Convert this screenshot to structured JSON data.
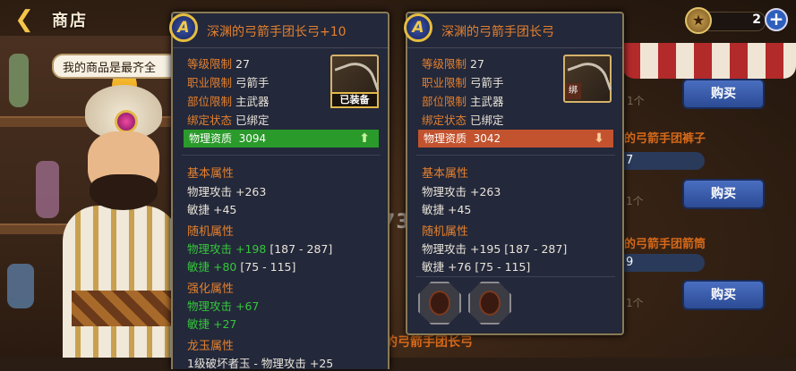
{
  "topbar": {
    "back_icon": "back-arrow-icon",
    "title": "商店"
  },
  "currency": {
    "value": "2",
    "icon": "medal-icon",
    "plus_label": "+"
  },
  "bubble": {
    "text": "我的商品是最齐全"
  },
  "shop_list": {
    "items": [
      {
        "qty": "1个",
        "buy": "购买"
      },
      {
        "title": "的弓箭手团裤子",
        "qty": "7",
        "qty2": "1个",
        "buy": "购买"
      },
      {
        "title": "的弓箭手团箭筒",
        "qty": "9",
        "qty2": "1个",
        "buy": "购买"
      }
    ],
    "bottom_title": "的弓箭手团长弓"
  },
  "watermark": "K73",
  "left_panel": {
    "grade": "A",
    "name": "深渊的弓箭手团长弓+10",
    "level_label": "等级限制",
    "level": "27",
    "class_label": "职业限制",
    "class": "弓箭手",
    "slot_label": "部位限制",
    "slot": "主武器",
    "bind_label": "绑定状态",
    "bind": "已绑定",
    "equipped_tag": "已装备",
    "aptitude_label": "物理资质",
    "aptitude": "3094",
    "base_title": "基本属性",
    "base_stats": [
      "物理攻击 +263",
      "敏捷 +45"
    ],
    "random_title": "随机属性",
    "random_stats": [
      {
        "name": "物理攻击",
        "bonus": "+198",
        "range": "[187 - 287]"
      },
      {
        "name": "敏捷",
        "bonus": "+80",
        "range": "[75 - 115]"
      }
    ],
    "enhance_title": "强化属性",
    "enhance_stats": [
      {
        "name": "物理攻击",
        "bonus": "+67"
      },
      {
        "name": "敏捷",
        "bonus": "+27"
      }
    ],
    "jade_title": "龙玉属性",
    "jade_stat": "1级破坏者玉 - 物理攻击 +25"
  },
  "right_panel": {
    "grade": "A",
    "name": "深渊的弓箭手团长弓",
    "level_label": "等级限制",
    "level": "27",
    "class_label": "职业限制",
    "class": "弓箭手",
    "slot_label": "部位限制",
    "slot": "主武器",
    "bind_label": "绑定状态",
    "bind": "已绑定",
    "bound_tag": "绑",
    "aptitude_label": "物理资质",
    "aptitude": "3042",
    "base_title": "基本属性",
    "base_stats": [
      "物理攻击 +263",
      "敏捷 +45"
    ],
    "random_title": "随机属性",
    "random_stats": [
      "物理攻击 +195 [187 - 287]",
      "敏捷 +76 [75 - 115]"
    ]
  },
  "colors": {
    "accent_orange": "#e4802e",
    "green": "#35c83a",
    "apt_up": "#2a9a2a",
    "apt_down": "#c2532e",
    "panel_bg": "#23283a"
  }
}
